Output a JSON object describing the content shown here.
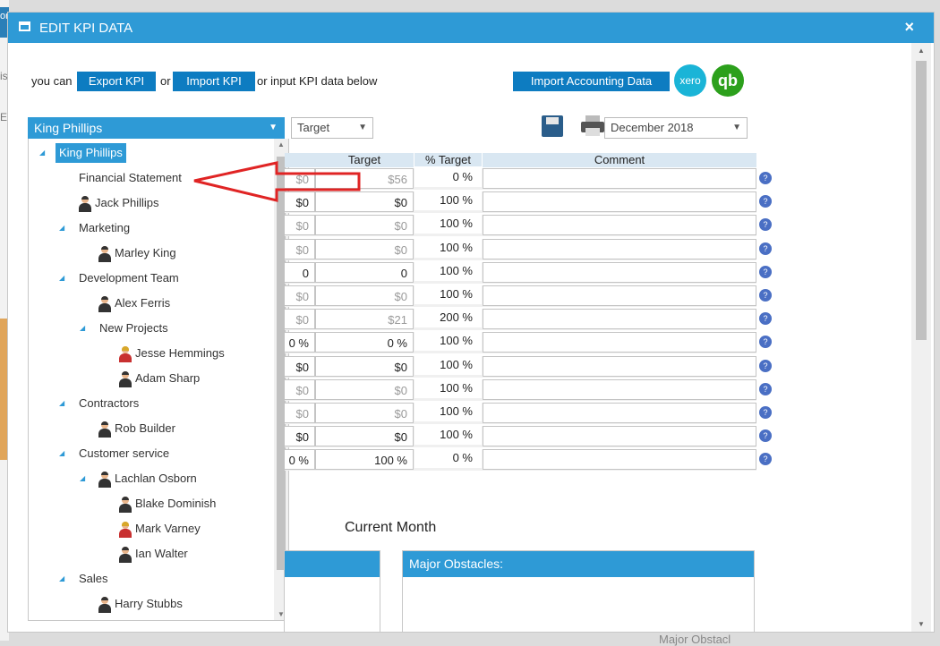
{
  "background": {
    "left_label_1": "or",
    "left_label_2": "is",
    "left_label_3": "Ex",
    "bottom_label": "Major Obstacl"
  },
  "dialog": {
    "title": "EDIT KPI DATA",
    "close_symbol": "×",
    "intro_prefix": "you can",
    "export_label": "Export KPI",
    "or_text": "or",
    "import_label": "Import KPI",
    "intro_suffix": "or input KPI data below",
    "import_accounting_label": "Import Accounting Data",
    "xero_label": "xero",
    "qb_label": "qb",
    "accent_color": "#2e9ad6"
  },
  "org_select": {
    "selected": "King Phillips",
    "tree": [
      {
        "label": "King Phillips",
        "type": "root",
        "expanded": true
      },
      {
        "label": "Financial Statement",
        "type": "item"
      },
      {
        "label": "Jack Phillips",
        "type": "person"
      },
      {
        "label": "Marketing",
        "type": "group"
      },
      {
        "label": "Marley King",
        "type": "person"
      },
      {
        "label": "Development Team",
        "type": "group"
      },
      {
        "label": "Alex Ferris",
        "type": "person"
      },
      {
        "label": "New Projects",
        "type": "group"
      },
      {
        "label": "Jesse Hemmings",
        "type": "person-female"
      },
      {
        "label": "Adam Sharp",
        "type": "person"
      },
      {
        "label": "Contractors",
        "type": "group"
      },
      {
        "label": "Rob Builder",
        "type": "person"
      },
      {
        "label": "Customer service",
        "type": "group"
      },
      {
        "label": "Lachlan Osborn",
        "type": "person"
      },
      {
        "label": "Blake Dominish",
        "type": "person"
      },
      {
        "label": "Mark Varney",
        "type": "person-female"
      },
      {
        "label": "Ian Walter",
        "type": "person"
      },
      {
        "label": "Sales",
        "type": "group"
      },
      {
        "label": "Harry Stubbs",
        "type": "person"
      }
    ]
  },
  "toolbar": {
    "view_select": "Target",
    "period_select": "December 2018",
    "save_icon": "save-icon",
    "print_icon": "print-icon"
  },
  "table": {
    "headers": [
      "Target",
      "% Target",
      "Comment"
    ],
    "rows": [
      {
        "actual": "$0",
        "target": "$56",
        "pct": "0 %",
        "comment": ""
      },
      {
        "actual": "$0",
        "target": "$0",
        "pct": "100 %",
        "comment": ""
      },
      {
        "actual": "$0",
        "target": "$0",
        "pct": "100 %",
        "comment": ""
      },
      {
        "actual": "$0",
        "target": "$0",
        "pct": "100 %",
        "comment": ""
      },
      {
        "actual": "0",
        "target": "0",
        "pct": "100 %",
        "comment": ""
      },
      {
        "actual": "$0",
        "target": "$0",
        "pct": "100 %",
        "comment": ""
      },
      {
        "actual": "$0",
        "target": "$21",
        "pct": "200 %",
        "comment": ""
      },
      {
        "actual": "0 %",
        "target": "0 %",
        "pct": "100 %",
        "comment": ""
      },
      {
        "actual": "$0",
        "target": "$0",
        "pct": "100 %",
        "comment": ""
      },
      {
        "actual": "$0",
        "target": "$0",
        "pct": "100 %",
        "comment": ""
      },
      {
        "actual": "$0",
        "target": "$0",
        "pct": "100 %",
        "comment": ""
      },
      {
        "actual": "$0",
        "target": "$0",
        "pct": "100 %",
        "comment": ""
      },
      {
        "actual": "0 %",
        "target": "100 %",
        "pct": "0 %",
        "comment": ""
      }
    ],
    "help_symbol": "?"
  },
  "bottom": {
    "current_month_label": "Current Month",
    "major_obstacles_label": "Major Obstacles:"
  }
}
